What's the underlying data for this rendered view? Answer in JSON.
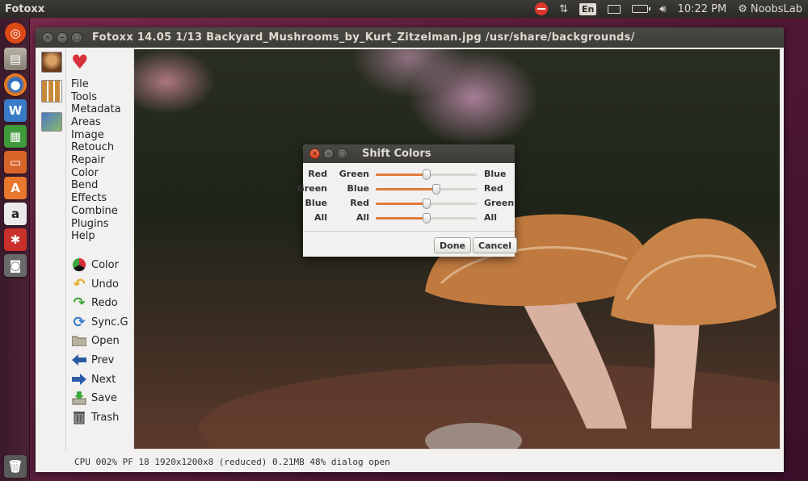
{
  "top_panel": {
    "app_name": "Fotoxx",
    "keyboard_layout": "En",
    "clock": "10:22 PM",
    "user": "NoobsLab"
  },
  "window": {
    "title": "Fotoxx 14.05  1/13  Backyard_Mushrooms_by_Kurt_Zitzelman.jpg  /usr/share/backgrounds/"
  },
  "menu": {
    "items": [
      "File",
      "Tools",
      "Metadata",
      "Areas",
      "Image",
      "Retouch",
      "Repair",
      "Color",
      "Bend",
      "Effects",
      "Combine",
      "Plugins",
      "Help"
    ]
  },
  "tools": {
    "items": [
      {
        "label": "Color",
        "icon": "color-wheel-icon"
      },
      {
        "label": "Undo",
        "icon": "undo-icon"
      },
      {
        "label": "Redo",
        "icon": "redo-icon"
      },
      {
        "label": "Sync.G",
        "icon": "sync-icon"
      },
      {
        "label": "Open",
        "icon": "folder-icon"
      },
      {
        "label": "Prev",
        "icon": "arrow-left-icon"
      },
      {
        "label": "Next",
        "icon": "arrow-right-icon"
      },
      {
        "label": "Save",
        "icon": "save-icon"
      },
      {
        "label": "Trash",
        "icon": "trash-icon"
      }
    ]
  },
  "status_bar": {
    "text": "CPU 002%  PF 18  1920x1200x8 (reduced)  0.21MB  48%  dialog open"
  },
  "dialog": {
    "title": "Shift Colors",
    "rows": [
      {
        "from": "Red",
        "mid": "Green",
        "to": "Blue",
        "value": 0.5
      },
      {
        "from": "Green",
        "mid": "Blue",
        "to": "Red",
        "value": 0.6
      },
      {
        "from": "Blue",
        "mid": "Red",
        "to": "Green",
        "value": 0.5
      },
      {
        "from": "All",
        "mid": "All",
        "to": "All",
        "value": 0.5
      }
    ],
    "done_label": "Done",
    "cancel_label": "Cancel"
  },
  "colors": {
    "accent": "#e07a3a",
    "panel": "#3c3b37",
    "window_bg": "#f2f1f0"
  }
}
